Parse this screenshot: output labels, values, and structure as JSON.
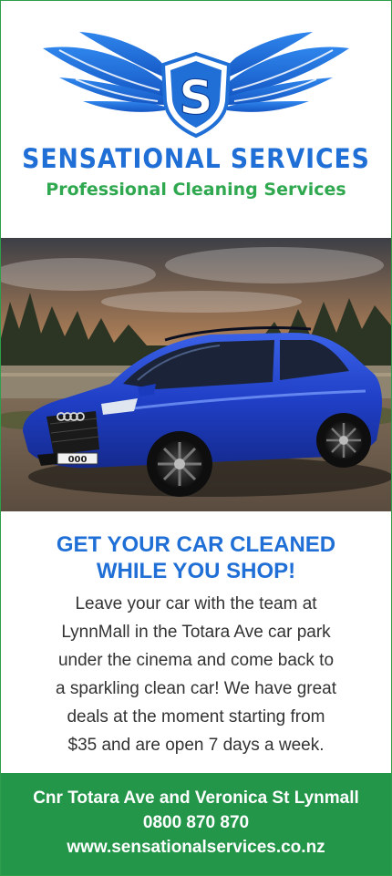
{
  "logo": {
    "icon": "winged-shield-icon",
    "letter": "S",
    "brand_name": "SENSATIONAL SERVICES",
    "tagline": "Professional Cleaning Services",
    "colors": {
      "primary_blue": "#1f6fd6",
      "accent_green": "#2fa84f"
    }
  },
  "hero": {
    "image": "blue-station-wagon-photo",
    "plate_text": "000"
  },
  "promo": {
    "headline_line1": "GET YOUR CAR CLEANED",
    "headline_line2": "WHILE YOU SHOP!",
    "body_lines": [
      "Leave your car with the team at",
      "LynnMall in the Totara Ave car park",
      "under the cinema and come back to",
      "a sparkling clean car! We have great",
      "deals at the moment starting from",
      "$35 and are open 7 days a week."
    ]
  },
  "footer": {
    "address": "Cnr Totara Ave and Veronica St Lynmall",
    "phone": "0800 870 870",
    "website": "www.sensationalservices.co.nz",
    "background": "#23964a"
  }
}
